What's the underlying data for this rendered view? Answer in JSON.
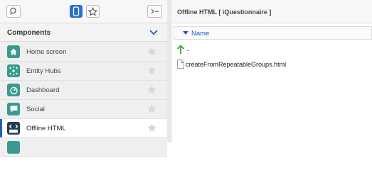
{
  "toolbar": {
    "search_icon": "search-icon",
    "phone_icon": "mobile-icon",
    "star_icon": "star-icon",
    "collapse_icon": "collapse-panel-icon"
  },
  "components": {
    "title": "Components",
    "chevron_color": "#1e5fbf",
    "items": [
      {
        "label": "Home screen",
        "icon": "home-icon",
        "active": false
      },
      {
        "label": "Entity Hubs",
        "icon": "hub-icon",
        "active": false
      },
      {
        "label": "Dashboard",
        "icon": "dashboard-icon",
        "active": false
      },
      {
        "label": "Social",
        "icon": "chat-icon",
        "active": false
      },
      {
        "label": "Offline HTML",
        "icon": "html-icon",
        "active": true
      }
    ]
  },
  "browser": {
    "path": "Offline HTML [ \\Questionnaire ]",
    "column_header": "Name",
    "up_label": "..",
    "files": [
      {
        "name": "createFromRepeatableGroups.html"
      }
    ]
  },
  "colors": {
    "accent": "#1e5fbf",
    "icon_teal": "#3a9a8f",
    "icon_dark": "#1f3d55",
    "up_arrow": "#3bb04a"
  }
}
